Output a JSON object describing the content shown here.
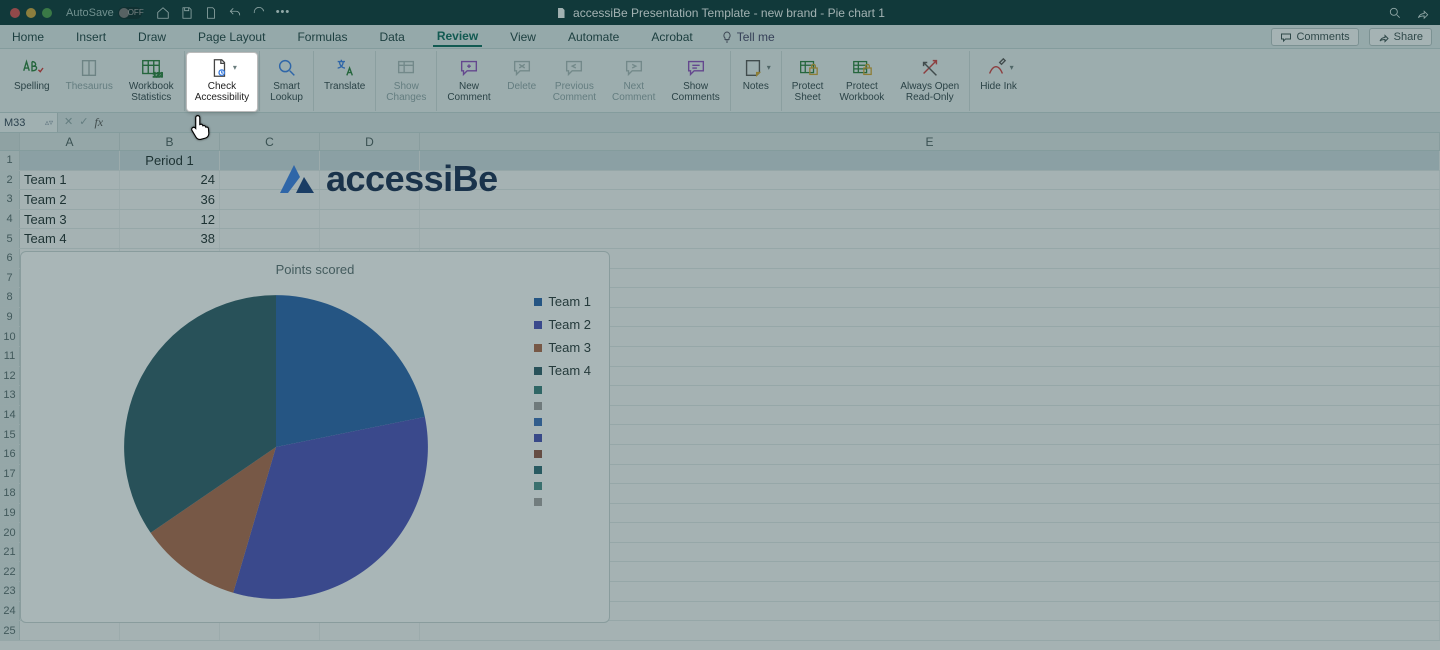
{
  "titlebar": {
    "autosave_label": "AutoSave",
    "autosave_state": "OFF",
    "doc_title": "accessiBe Presentation Template - new brand - Pie chart 1"
  },
  "tabs": {
    "items": [
      "Home",
      "Insert",
      "Draw",
      "Page Layout",
      "Formulas",
      "Data",
      "Review",
      "View",
      "Automate",
      "Acrobat"
    ],
    "active_index": 6,
    "tell_me": "Tell me",
    "comments_btn": "Comments",
    "share_btn": "Share"
  },
  "ribbon": {
    "spelling": "Spelling",
    "thesaurus": "Thesaurus",
    "workbook_stats": "Workbook\nStatistics",
    "check_access": "Check\nAccessibility",
    "smart_lookup": "Smart\nLookup",
    "translate": "Translate",
    "show_changes": "Show\nChanges",
    "new_comment": "New\nComment",
    "delete": "Delete",
    "previous_comment": "Previous\nComment",
    "next_comment": "Next\nComment",
    "show_comments": "Show\nComments",
    "notes": "Notes",
    "protect_sheet": "Protect\nSheet",
    "protect_workbook": "Protect\nWorkbook",
    "always_open_ro": "Always Open\nRead-Only",
    "hide_ink": "Hide Ink"
  },
  "formula_bar": {
    "name_box": "M33",
    "formula": ""
  },
  "columns": [
    "A",
    "B",
    "C",
    "D",
    "E"
  ],
  "sheet": {
    "header_row": {
      "A": "",
      "B": "Period 1"
    },
    "rows": [
      {
        "n": "2",
        "A": "Team 1",
        "B": "24"
      },
      {
        "n": "3",
        "A": "Team 2",
        "B": "36"
      },
      {
        "n": "4",
        "A": "Team 3",
        "B": "12"
      },
      {
        "n": "5",
        "A": "Team 4",
        "B": "38"
      }
    ],
    "empty_rows": [
      "6",
      "7",
      "8",
      "9",
      "10",
      "11",
      "12",
      "13",
      "14",
      "15",
      "16",
      "17",
      "18",
      "19",
      "20",
      "21",
      "22",
      "23",
      "24",
      "25"
    ]
  },
  "logo_text": "accessiBe",
  "chart_data": {
    "type": "pie",
    "title": "Points scored",
    "categories": [
      "Team 1",
      "Team 2",
      "Team 3",
      "Team 4"
    ],
    "values": [
      24,
      36,
      12,
      38
    ],
    "colors": [
      "#2a63a8",
      "#4a51b5",
      "#a8674a",
      "#2e5c68"
    ],
    "extra_legend_colors": [
      "#3a7d7a",
      "#9c9c9c",
      "#3d6fb6",
      "#4750b0",
      "#8d5646",
      "#2f6a73",
      "#4a8d87",
      "#a0a0a0"
    ]
  }
}
